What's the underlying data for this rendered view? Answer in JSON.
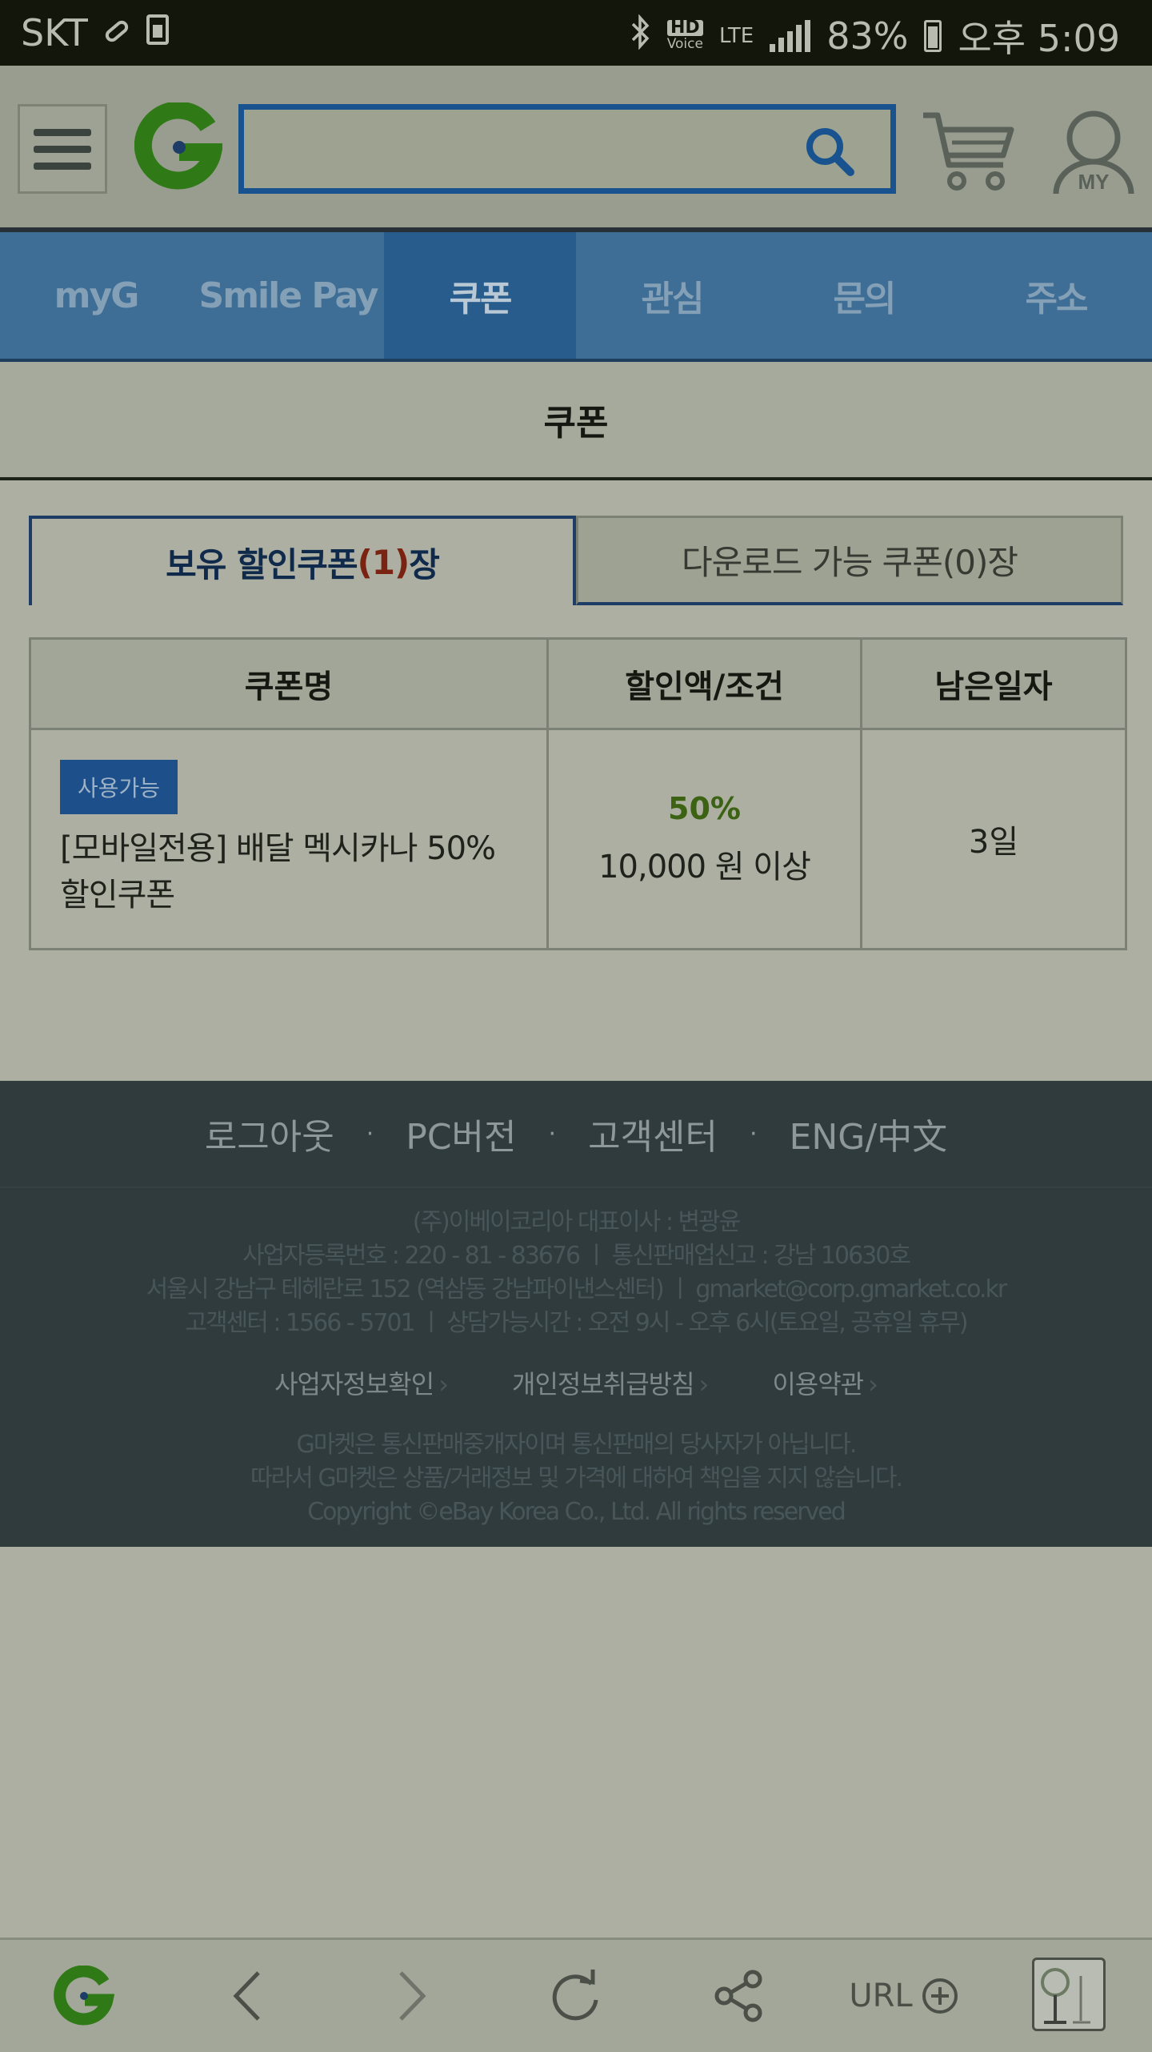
{
  "status_bar": {
    "carrier": "SKT",
    "hd_label": "HD",
    "voice_label": "Voice",
    "network": "LTE",
    "battery": "83%",
    "time": "오후 5:09"
  },
  "header": {
    "logo": "G",
    "search": {
      "value": "",
      "placeholder": ""
    },
    "my_label": "MY"
  },
  "nav": {
    "tabs": [
      {
        "label": "myG",
        "active": false
      },
      {
        "label": "Smile Pay",
        "active": false
      },
      {
        "label": "쿠폰",
        "active": true
      },
      {
        "label": "관심",
        "active": false
      },
      {
        "label": "문의",
        "active": false
      },
      {
        "label": "주소",
        "active": false
      }
    ]
  },
  "page": {
    "title": "쿠폰"
  },
  "coupon_tabs": {
    "owned_prefix": "보유 할인쿠폰",
    "owned_count": "(1)",
    "owned_suffix": "장",
    "download_label": "다운로드 가능 쿠폰(0)장"
  },
  "table": {
    "headers": [
      "쿠폰명",
      "할인액/조건",
      "남은일자"
    ],
    "rows": [
      {
        "badge": "사용가능",
        "name": "[모바일전용] 배달 멕시카나 50% 할인쿠폰",
        "discount": "50%",
        "condition": "10,000 원 이상",
        "remaining": "3일"
      }
    ]
  },
  "footer": {
    "links": [
      "로그아웃",
      "PC버전",
      "고객센터",
      "ENG/中文"
    ],
    "separator": "·",
    "company_lines": [
      "(주)이베이코리아 대표이사 : 변광윤",
      "사업자등록번호 : 220 - 81 - 83676 ㅣ 통신판매업신고 : 강남 10630호",
      "서울시 강남구 테헤란로 152 (역삼동 강남파이낸스센터) ㅣ gmarket@corp.gmarket.co.kr",
      "고객센터 : 1566 - 5701 ㅣ 상담가능시간 : 오전 9시 - 오후 6시(토요일, 공휴일 휴무)"
    ],
    "policies": [
      "사업자정보확인",
      "개인정보취급방침",
      "이용약관"
    ],
    "notice_lines": [
      "G마켓은 통신판매중개자이며 통신판매의 당사자가 아닙니다.",
      "따라서 G마켓은 상품/거래정보 및 가격에 대하여 책임을 지지 않습니다.",
      "Copyright ©eBay Korea Co., Ltd. All rights reserved"
    ]
  },
  "bottom_bar": {
    "url_label": "URL"
  },
  "colors": {
    "brand_green": "#2f7a17",
    "nav_blue": "#3e6d96",
    "accent_red": "#7a2312",
    "footer_bg": "#2f3b3d"
  }
}
